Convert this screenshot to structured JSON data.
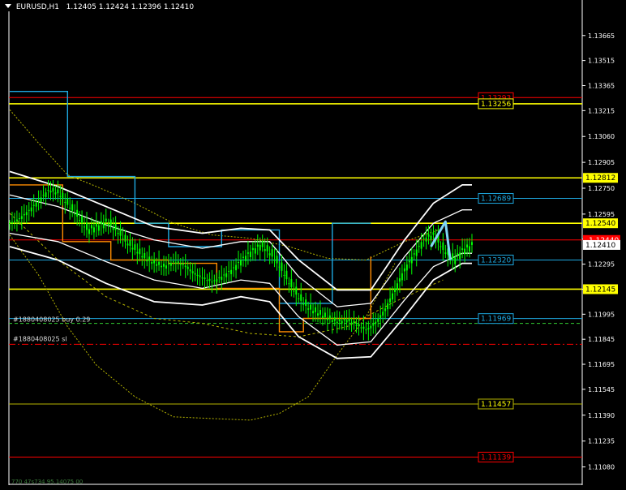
{
  "header": {
    "symbol": "EURUSD,H1",
    "ohlc": "1.12405 1.12424 1.12396 1.12410"
  },
  "colors": {
    "background": "#000000",
    "candle": "#00ff00",
    "band": "#ffffff",
    "support": "#ffff00",
    "resistance": "#ff0000",
    "cyan": "#1ea9e1",
    "orange": "#ff8c00",
    "olive": "#b6b400",
    "dashed_green": "#32cd32",
    "arrow": "#7fd6f5"
  },
  "trade_labels": {
    "buy": "#1880408025 buy 0.29",
    "sl": "#1880408025 sl"
  },
  "footer_text": "770 47s734 95.14075 00",
  "chart_data": {
    "type": "candlestick",
    "symbol": "EURUSD",
    "timeframe": "H1",
    "ylim": [
      1.11,
      1.138
    ],
    "y_ticks": [
      "1.13665",
      "1.13515",
      "1.13365",
      "1.13215",
      "1.13060",
      "1.12905",
      "1.12750",
      "1.12595",
      "1.12445",
      "1.12295",
      "1.12145",
      "1.11995",
      "1.11845",
      "1.11695",
      "1.11545",
      "1.11390",
      "1.11235",
      "1.11080"
    ],
    "current_price": "1.12410",
    "horizontal_levels": [
      {
        "label": "1.13293",
        "value": 1.13293,
        "color": "#ff0000"
      },
      {
        "label": "1.13256",
        "value": 1.13256,
        "color": "#ffff00"
      },
      {
        "label": "1.12812",
        "value": 1.12812,
        "color": "#ffff00"
      },
      {
        "label": "1.12689",
        "value": 1.12689,
        "color": "#1ea9e1"
      },
      {
        "label": "1.12540",
        "value": 1.1254,
        "color": "#ffff00"
      },
      {
        "label": "1.12440",
        "value": 1.1244,
        "color": "#ff0000"
      },
      {
        "label": "1.12320",
        "value": 1.1232,
        "color": "#1ea9e1"
      },
      {
        "label": "1.12145",
        "value": 1.12145,
        "color": "#ffff00"
      },
      {
        "label": "1.11969",
        "value": 1.11969,
        "color": "#1ea9e1"
      },
      {
        "label": "1.11457",
        "value": 1.11457,
        "color": "#b6b400"
      },
      {
        "label": "1.11139",
        "value": 1.11139,
        "color": "#ff0000"
      }
    ],
    "trade_lines": [
      {
        "name": "buy",
        "value": 1.1194
      },
      {
        "name": "sl",
        "value": 1.11815
      }
    ],
    "price_path": [
      [
        0,
        1.1254
      ],
      [
        4,
        1.1257
      ],
      [
        8,
        1.1262
      ],
      [
        12,
        1.1268
      ],
      [
        16,
        1.1274
      ],
      [
        20,
        1.1272
      ],
      [
        24,
        1.1265
      ],
      [
        28,
        1.1258
      ],
      [
        32,
        1.125
      ],
      [
        36,
        1.1252
      ],
      [
        40,
        1.1255
      ],
      [
        44,
        1.125
      ],
      [
        48,
        1.1243
      ],
      [
        52,
        1.1238
      ],
      [
        56,
        1.1233
      ],
      [
        60,
        1.123
      ],
      [
        64,
        1.1228
      ],
      [
        68,
        1.1231
      ],
      [
        72,
        1.1229
      ],
      [
        76,
        1.1224
      ],
      [
        80,
        1.1221
      ],
      [
        84,
        1.1219
      ],
      [
        88,
        1.1222
      ],
      [
        92,
        1.1226
      ],
      [
        96,
        1.1232
      ],
      [
        100,
        1.1237
      ],
      [
        104,
        1.1241
      ],
      [
        108,
        1.1236
      ],
      [
        112,
        1.1228
      ],
      [
        116,
        1.1218
      ],
      [
        120,
        1.1209
      ],
      [
        124,
        1.1203
      ],
      [
        128,
        1.12
      ],
      [
        132,
        1.1197
      ],
      [
        136,
        1.1195
      ],
      [
        140,
        1.1196
      ],
      [
        144,
        1.1193
      ],
      [
        148,
        1.119
      ],
      [
        152,
        1.1195
      ],
      [
        156,
        1.1203
      ],
      [
        160,
        1.1215
      ],
      [
        164,
        1.1227
      ],
      [
        168,
        1.1236
      ],
      [
        172,
        1.1245
      ],
      [
        176,
        1.1247
      ],
      [
        180,
        1.1238
      ],
      [
        184,
        1.1232
      ],
      [
        188,
        1.1238
      ],
      [
        192,
        1.1241
      ]
    ],
    "bands": {
      "outer_upper": [
        [
          0,
          1.1285
        ],
        [
          20,
          1.1276
        ],
        [
          40,
          1.1264
        ],
        [
          60,
          1.1252
        ],
        [
          80,
          1.1248
        ],
        [
          96,
          1.1251
        ],
        [
          108,
          1.125
        ],
        [
          120,
          1.1232
        ],
        [
          136,
          1.1214
        ],
        [
          150,
          1.1214
        ],
        [
          164,
          1.1244
        ],
        [
          176,
          1.1266
        ],
        [
          188,
          1.1277
        ],
        [
          192,
          1.1277
        ]
      ],
      "inner_upper": [
        [
          0,
          1.1271
        ],
        [
          20,
          1.1264
        ],
        [
          40,
          1.1253
        ],
        [
          60,
          1.1244
        ],
        [
          80,
          1.1239
        ],
        [
          96,
          1.1243
        ],
        [
          108,
          1.1243
        ],
        [
          120,
          1.1222
        ],
        [
          136,
          1.1204
        ],
        [
          150,
          1.1206
        ],
        [
          164,
          1.1234
        ],
        [
          176,
          1.1254
        ],
        [
          188,
          1.1262
        ],
        [
          192,
          1.1262
        ]
      ],
      "inner_lower": [
        [
          0,
          1.1248
        ],
        [
          20,
          1.1243
        ],
        [
          40,
          1.1231
        ],
        [
          60,
          1.122
        ],
        [
          80,
          1.1215
        ],
        [
          96,
          1.122
        ],
        [
          108,
          1.1218
        ],
        [
          120,
          1.1198
        ],
        [
          136,
          1.1181
        ],
        [
          150,
          1.1183
        ],
        [
          164,
          1.1208
        ],
        [
          176,
          1.1228
        ],
        [
          188,
          1.1236
        ],
        [
          192,
          1.1236
        ]
      ],
      "outer_lower": [
        [
          0,
          1.124
        ],
        [
          20,
          1.1232
        ],
        [
          40,
          1.1218
        ],
        [
          60,
          1.1207
        ],
        [
          80,
          1.1205
        ],
        [
          96,
          1.121
        ],
        [
          108,
          1.1207
        ],
        [
          120,
          1.1186
        ],
        [
          136,
          1.1173
        ],
        [
          150,
          1.1174
        ],
        [
          164,
          1.1198
        ],
        [
          176,
          1.122
        ],
        [
          188,
          1.123
        ],
        [
          192,
          1.123
        ]
      ]
    },
    "envelope_upper": [
      [
        0,
        1.1322
      ],
      [
        12,
        1.1302
      ],
      [
        24,
        1.1283
      ],
      [
        36,
        1.1276
      ],
      [
        52,
        1.1266
      ],
      [
        68,
        1.1254
      ],
      [
        84,
        1.1247
      ],
      [
        100,
        1.1245
      ],
      [
        116,
        1.124
      ],
      [
        132,
        1.1233
      ],
      [
        148,
        1.1232
      ],
      [
        164,
        1.1243
      ],
      [
        180,
        1.1251
      ]
    ],
    "envelope_lower": [
      [
        0,
        1.1247
      ],
      [
        12,
        1.1223
      ],
      [
        24,
        1.1192
      ],
      [
        36,
        1.1169
      ],
      [
        52,
        1.115
      ],
      [
        68,
        1.1138
      ],
      [
        84,
        1.1137
      ],
      [
        100,
        1.1136
      ],
      [
        112,
        1.114
      ],
      [
        124,
        1.115
      ],
      [
        136,
        1.1175
      ],
      [
        148,
        1.1198
      ],
      [
        160,
        1.123
      ]
    ],
    "envelope_mid": [
      [
        0,
        1.126
      ],
      [
        20,
        1.1232
      ],
      [
        40,
        1.121
      ],
      [
        60,
        1.1197
      ],
      [
        80,
        1.1194
      ],
      [
        100,
        1.1188
      ],
      [
        120,
        1.1186
      ],
      [
        140,
        1.1192
      ],
      [
        160,
        1.1207
      ],
      [
        180,
        1.122
      ]
    ],
    "cyan_step": [
      [
        0,
        1.1333
      ],
      [
        24,
        1.1333
      ],
      [
        24,
        1.1282
      ],
      [
        52,
        1.1282
      ],
      [
        52,
        1.1254
      ],
      [
        66,
        1.1254
      ],
      [
        66,
        1.124
      ],
      [
        88,
        1.124
      ],
      [
        88,
        1.125
      ],
      [
        112,
        1.125
      ],
      [
        112,
        1.1206
      ],
      [
        134,
        1.1206
      ],
      [
        134,
        1.1254
      ],
      [
        150,
        1.1254
      ]
    ],
    "orange_step": [
      [
        0,
        1.1277
      ],
      [
        22,
        1.1277
      ],
      [
        22,
        1.1243
      ],
      [
        42,
        1.1243
      ],
      [
        42,
        1.1232
      ],
      [
        66,
        1.1232
      ],
      [
        66,
        1.123
      ],
      [
        86,
        1.123
      ],
      [
        86,
        1.1215
      ],
      [
        112,
        1.1215
      ],
      [
        112,
        1.1189
      ],
      [
        122,
        1.1189
      ],
      [
        122,
        1.1197
      ],
      [
        150,
        1.1197
      ],
      [
        150,
        1.1234
      ]
    ],
    "arrow": {
      "x": [
        175,
        181,
        183
      ],
      "y": [
        1.124,
        1.1255,
        1.1232
      ]
    }
  }
}
